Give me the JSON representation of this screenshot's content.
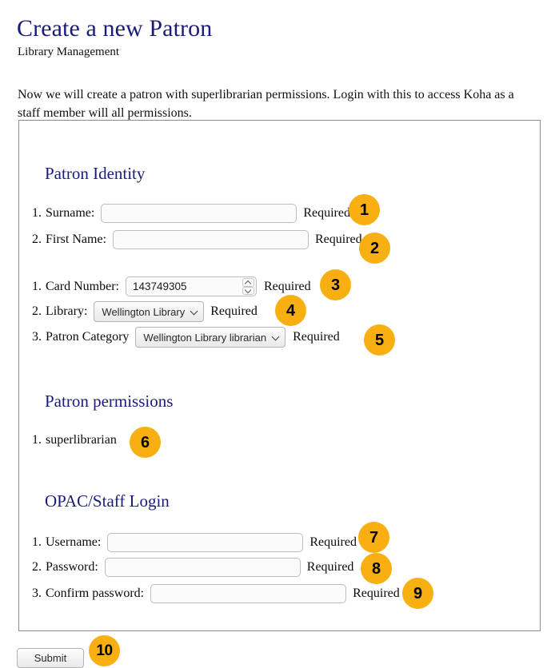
{
  "page": {
    "title": "Create a new Patron",
    "subtitle": "Library Management",
    "intro": "Now we will create a patron with superlibrarian permissions. Login with this to access Koha as a staff member will all permissions."
  },
  "theme": {
    "heading_color": "#1b1b7a",
    "badge_color": "#f8af12",
    "badge_text_color": "#000000",
    "panel_border_color": "#8d8d8d"
  },
  "sections": {
    "identity": {
      "heading": "Patron Identity",
      "fields": [
        {
          "index": "1.",
          "label": "Surname:",
          "type": "text",
          "value": "",
          "placeholder": "",
          "required_label": "Required",
          "badge": "1"
        },
        {
          "index": "2.",
          "label": "First Name:",
          "type": "text",
          "value": "",
          "placeholder": "",
          "required_label": "Required",
          "badge": "2"
        },
        {
          "index": "1.",
          "label": "Card Number:",
          "type": "number",
          "value": "143749305",
          "required_label": "Required",
          "badge": "3"
        },
        {
          "index": "2.",
          "label": "Library:",
          "type": "select",
          "value": "Wellington Library",
          "required_label": "Required",
          "badge": "4"
        },
        {
          "index": "3.",
          "label": "Patron Category",
          "type": "select",
          "value": "Wellington Library librarian",
          "required_label": "Required",
          "badge": "5"
        }
      ]
    },
    "permissions": {
      "heading": "Patron permissions",
      "items": [
        {
          "index": "1.",
          "label": "superlibrarian",
          "badge": "6"
        }
      ]
    },
    "login": {
      "heading": "OPAC/Staff Login",
      "fields": [
        {
          "index": "1.",
          "label": "Username:",
          "type": "text",
          "value": "",
          "required_label": "Required",
          "badge": "7"
        },
        {
          "index": "2.",
          "label": "Password:",
          "type": "password",
          "value": "",
          "required_label": "Required",
          "badge": "8"
        },
        {
          "index": "3.",
          "label": "Confirm password:",
          "type": "password",
          "value": "",
          "required_label": "Required",
          "badge": "9"
        }
      ]
    }
  },
  "footer": {
    "submit_label": "Submit",
    "submit_badge": "10"
  }
}
